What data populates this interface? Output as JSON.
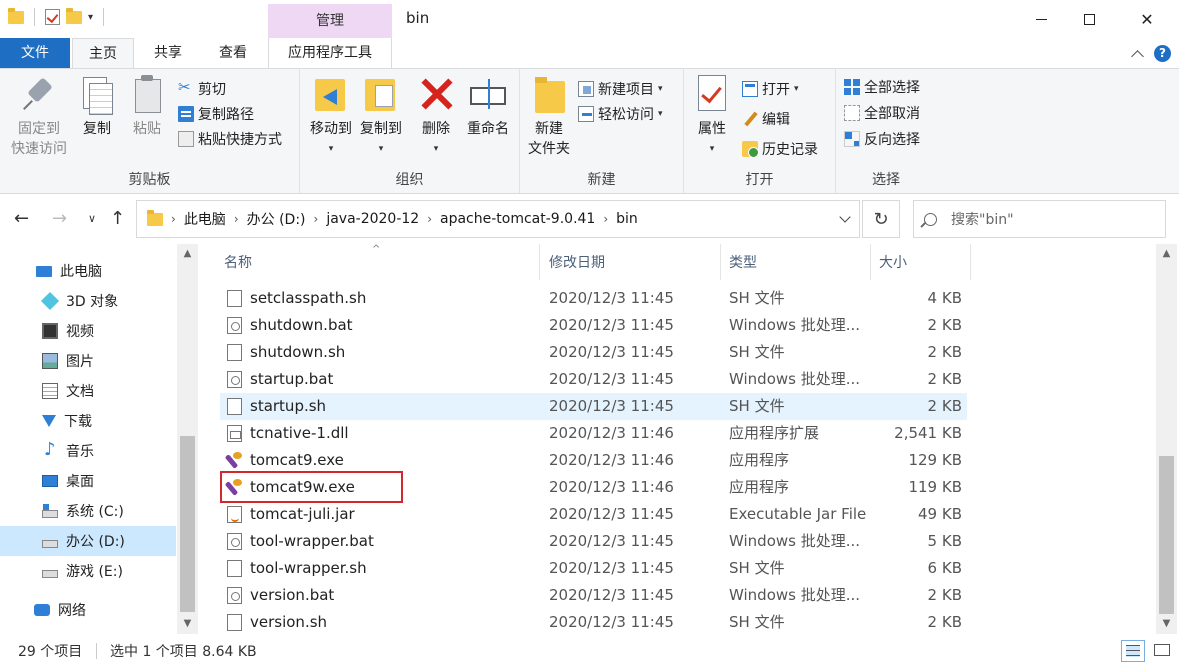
{
  "window": {
    "title": "bin",
    "manage_label": "管理"
  },
  "tabs": {
    "file": "文件",
    "home": "主页",
    "share": "共享",
    "view": "查看",
    "app_tools": "应用程序工具"
  },
  "ribbon": {
    "clipboard": {
      "label": "剪贴板",
      "pin": "固定到\n快速访问",
      "pin_line1": "固定到",
      "pin_line2": "快速访问",
      "copy": "复制",
      "paste": "粘贴",
      "cut": "剪切",
      "copy_path": "复制路径",
      "paste_shortcut": "粘贴快捷方式"
    },
    "organize": {
      "label": "组织",
      "move_to": "移动到",
      "copy_to": "复制到",
      "delete": "删除",
      "rename": "重命名"
    },
    "new": {
      "label": "新建",
      "new_folder_line1": "新建",
      "new_folder_line2": "文件夹",
      "new_item": "新建项目",
      "easy_access": "轻松访问"
    },
    "open": {
      "label": "打开",
      "properties": "属性",
      "open": "打开",
      "edit": "编辑",
      "history": "历史记录"
    },
    "select": {
      "label": "选择",
      "select_all": "全部选择",
      "select_none": "全部取消",
      "invert": "反向选择"
    }
  },
  "address": {
    "crumbs": [
      "此电脑",
      "办公 (D:)",
      "java-2020-12",
      "apache-tomcat-9.0.41",
      "bin"
    ],
    "search_placeholder": "搜索\"bin\""
  },
  "nav_pane": {
    "items": [
      {
        "label": "此电脑",
        "icon": "pc-icon"
      },
      {
        "label": "3D 对象",
        "icon": "3d-objects-icon"
      },
      {
        "label": "视频",
        "icon": "video-icon"
      },
      {
        "label": "图片",
        "icon": "pictures-icon"
      },
      {
        "label": "文档",
        "icon": "documents-icon"
      },
      {
        "label": "下载",
        "icon": "downloads-icon"
      },
      {
        "label": "音乐",
        "icon": "music-icon"
      },
      {
        "label": "桌面",
        "icon": "desktop-icon"
      },
      {
        "label": "系统 (C:)",
        "icon": "system-drive-icon"
      },
      {
        "label": "办公 (D:)",
        "icon": "drive-icon"
      },
      {
        "label": "游戏 (E:)",
        "icon": "drive-icon"
      },
      {
        "label": "网络",
        "icon": "network-icon"
      }
    ]
  },
  "file_list": {
    "columns": {
      "name": "名称",
      "date": "修改日期",
      "type": "类型",
      "size": "大小"
    },
    "rows": [
      {
        "name": "setclasspath.sh",
        "date": "2020/12/3 11:45",
        "type": "SH 文件",
        "size": "4 KB",
        "icon": "sh"
      },
      {
        "name": "shutdown.bat",
        "date": "2020/12/3 11:45",
        "type": "Windows 批处理...",
        "size": "2 KB",
        "icon": "bat"
      },
      {
        "name": "shutdown.sh",
        "date": "2020/12/3 11:45",
        "type": "SH 文件",
        "size": "2 KB",
        "icon": "sh"
      },
      {
        "name": "startup.bat",
        "date": "2020/12/3 11:45",
        "type": "Windows 批处理...",
        "size": "2 KB",
        "icon": "bat"
      },
      {
        "name": "startup.sh",
        "date": "2020/12/3 11:45",
        "type": "SH 文件",
        "size": "2 KB",
        "icon": "sh"
      },
      {
        "name": "tcnative-1.dll",
        "date": "2020/12/3 11:46",
        "type": "应用程序扩展",
        "size": "2,541 KB",
        "icon": "dll"
      },
      {
        "name": "tomcat9.exe",
        "date": "2020/12/3 11:46",
        "type": "应用程序",
        "size": "129 KB",
        "icon": "exe"
      },
      {
        "name": "tomcat9w.exe",
        "date": "2020/12/3 11:46",
        "type": "应用程序",
        "size": "119 KB",
        "icon": "exe"
      },
      {
        "name": "tomcat-juli.jar",
        "date": "2020/12/3 11:45",
        "type": "Executable Jar File",
        "size": "49 KB",
        "icon": "jar"
      },
      {
        "name": "tool-wrapper.bat",
        "date": "2020/12/3 11:45",
        "type": "Windows 批处理...",
        "size": "5 KB",
        "icon": "bat"
      },
      {
        "name": "tool-wrapper.sh",
        "date": "2020/12/3 11:45",
        "type": "SH 文件",
        "size": "6 KB",
        "icon": "sh"
      },
      {
        "name": "version.bat",
        "date": "2020/12/3 11:45",
        "type": "Windows 批处理...",
        "size": "2 KB",
        "icon": "bat"
      },
      {
        "name": "version.sh",
        "date": "2020/12/3 11:45",
        "type": "SH 文件",
        "size": "2 KB",
        "icon": "sh"
      }
    ]
  },
  "status": {
    "item_count": "29 个项目",
    "selection": "选中 1 个项目  8.64 KB"
  },
  "colors": {
    "file_tab": "#1e6fc4",
    "manage_tab": "#efd8f3",
    "selection": "#cce8ff",
    "highlight_box": "#d6252b"
  }
}
